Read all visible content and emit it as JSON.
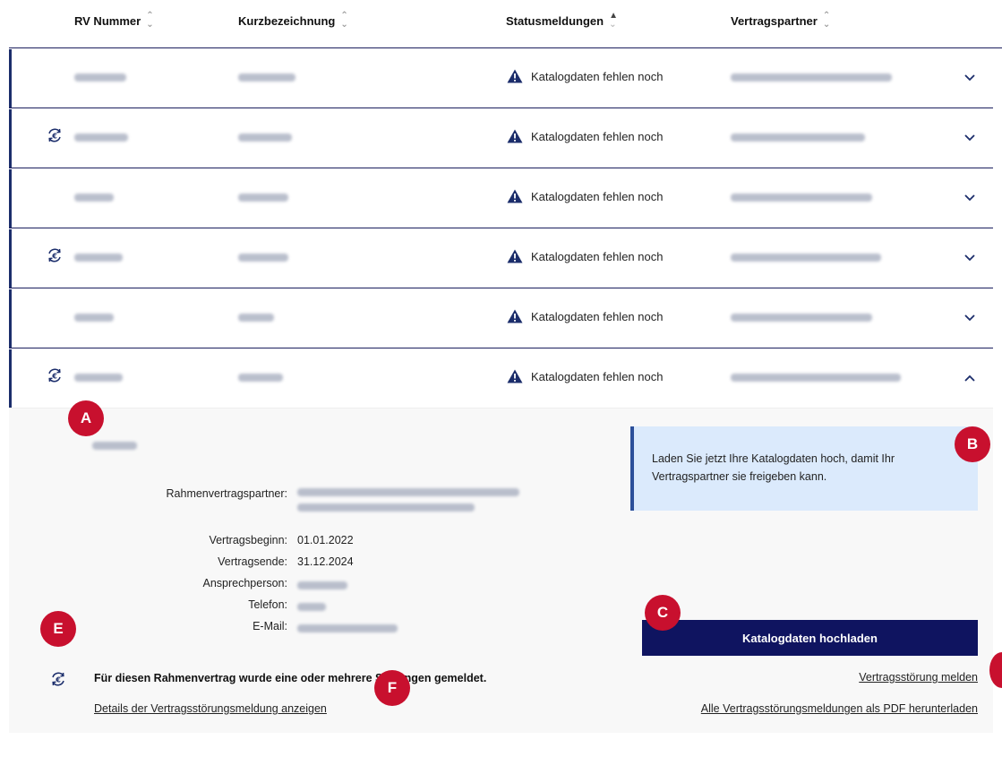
{
  "table": {
    "columns": [
      {
        "label": "RV Nummer",
        "sort": "none"
      },
      {
        "label": "Kurzbezeichnung",
        "sort": "none"
      },
      {
        "label": "Statusmeldungen",
        "sort": "asc"
      },
      {
        "label": "Vertragspartner",
        "sort": "none"
      }
    ],
    "rows": [
      {
        "status": "Katalogdaten fehlen noch",
        "has_disruption": false,
        "expanded": false
      },
      {
        "status": "Katalogdaten fehlen noch",
        "has_disruption": true,
        "expanded": false
      },
      {
        "status": "Katalogdaten fehlen noch",
        "has_disruption": false,
        "expanded": false
      },
      {
        "status": "Katalogdaten fehlen noch",
        "has_disruption": true,
        "expanded": false
      },
      {
        "status": "Katalogdaten fehlen noch",
        "has_disruption": false,
        "expanded": false
      },
      {
        "status": "Katalogdaten fehlen noch",
        "has_disruption": true,
        "expanded": true
      }
    ]
  },
  "detail": {
    "labels": {
      "partner": "Rahmenvertragspartner:",
      "start": "Vertragsbeginn:",
      "end": "Vertragsende:",
      "contact": "Ansprechperson:",
      "phone": "Telefon:",
      "email": "E-Mail:"
    },
    "values": {
      "start": "01.01.2022",
      "end": "31.12.2024"
    },
    "info_message": "Laden Sie jetzt Ihre Katalogdaten hoch, damit Ihr Vertragspartner sie freigeben kann.",
    "upload_button": "Katalogdaten hochladen",
    "report_link": "Vertragsstörung melden",
    "download_link": "Alle Vertragsstörungsmeldungen als PDF herunterladen",
    "disruption_text": "Für diesen Rahmenvertrag wurde eine oder mehrere Störungen gemeldet.",
    "details_link": "Details der Vertragsstörungsmeldung anzeigen"
  },
  "annotations": [
    "A",
    "B",
    "C",
    "E",
    "F"
  ],
  "colors": {
    "primary": "#0f1460",
    "row_border": "#1b1f5e",
    "info_bg": "#dbeafc",
    "badge": "#c8102e",
    "warning_icon": "#1b2d6b"
  },
  "icons": {
    "sort": "sort-arrows-icon",
    "warning": "warning-triangle-icon",
    "sync": "sync-euro-icon",
    "expand": "chevron-down-icon",
    "collapse": "chevron-up-icon"
  }
}
